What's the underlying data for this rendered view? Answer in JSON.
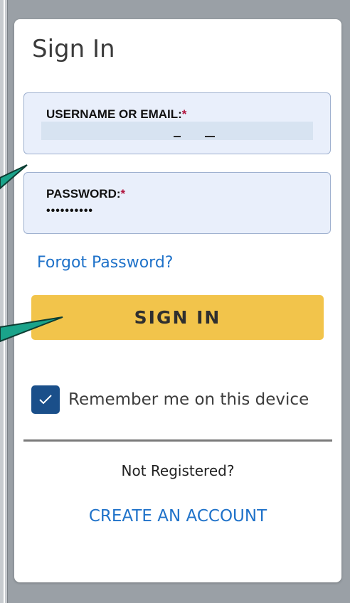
{
  "title": "Sign In",
  "username": {
    "label": "USERNAME OR EMAIL:",
    "required_marker": "*",
    "value": ""
  },
  "password": {
    "label": "PASSWORD:",
    "required_marker": "*",
    "value": "••••••••••"
  },
  "forgot_password": "Forgot Password?",
  "sign_in_button": "SIGN IN",
  "remember_me": {
    "label": "Remember me on this device",
    "checked": true
  },
  "not_registered": "Not Registered?",
  "create_account": "CREATE AN ACCOUNT",
  "colors": {
    "accent_blue": "#1f72c9",
    "button_yellow": "#f2c44b",
    "checkbox_blue": "#1a4f8a",
    "field_background": "#e9effb",
    "annotation_teal": "#1aa38a"
  },
  "icons": {
    "checkbox": "checkmark-icon",
    "annotations": "callout-arrow-icon"
  }
}
